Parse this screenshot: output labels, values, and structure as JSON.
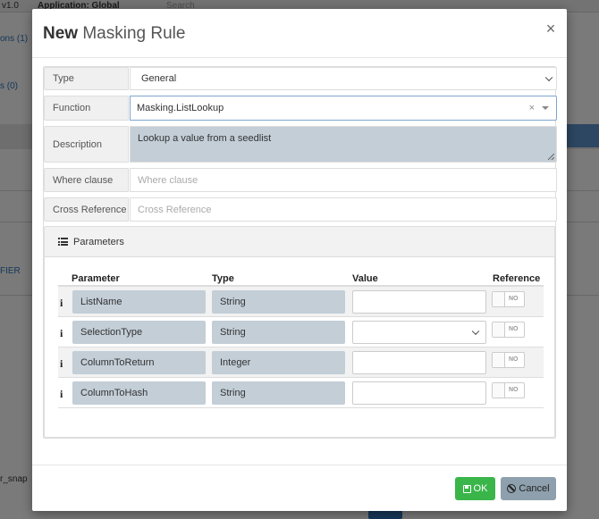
{
  "background": {
    "topbar": {
      "version": "v1.0",
      "app_label": "Application: Global",
      "search_placeholder": "Search"
    },
    "left_links": [
      "ons (1)",
      "s (0)",
      "FIER",
      "r_snap"
    ]
  },
  "modal": {
    "title_strong": "New",
    "title_rest": "Masking Rule",
    "close_label": "×",
    "fields": {
      "type": {
        "label": "Type",
        "value": "General"
      },
      "function": {
        "label": "Function",
        "value": "Masking.ListLookup",
        "clear": "×"
      },
      "description": {
        "label": "Description",
        "value": "Lookup a value from a seedlist"
      },
      "where": {
        "label": "Where clause",
        "placeholder": "Where clause"
      },
      "crossref": {
        "label": "Cross Reference",
        "placeholder": "Cross Reference"
      }
    },
    "parameters": {
      "title": "Parameters",
      "columns": {
        "parameter": "Parameter",
        "type": "Type",
        "value": "Value",
        "reference": "Reference"
      },
      "info_glyph": "i",
      "toggle_text": "NO",
      "rows": [
        {
          "name": "ListName",
          "type": "String",
          "value_kind": "text"
        },
        {
          "name": "SelectionType",
          "type": "String",
          "value_kind": "select"
        },
        {
          "name": "ColumnToReturn",
          "type": "Integer",
          "value_kind": "text"
        },
        {
          "name": "ColumnToHash",
          "type": "String",
          "value_kind": "text"
        }
      ]
    },
    "footer": {
      "ok_label": "OK",
      "cancel_label": "Cancel"
    }
  }
}
